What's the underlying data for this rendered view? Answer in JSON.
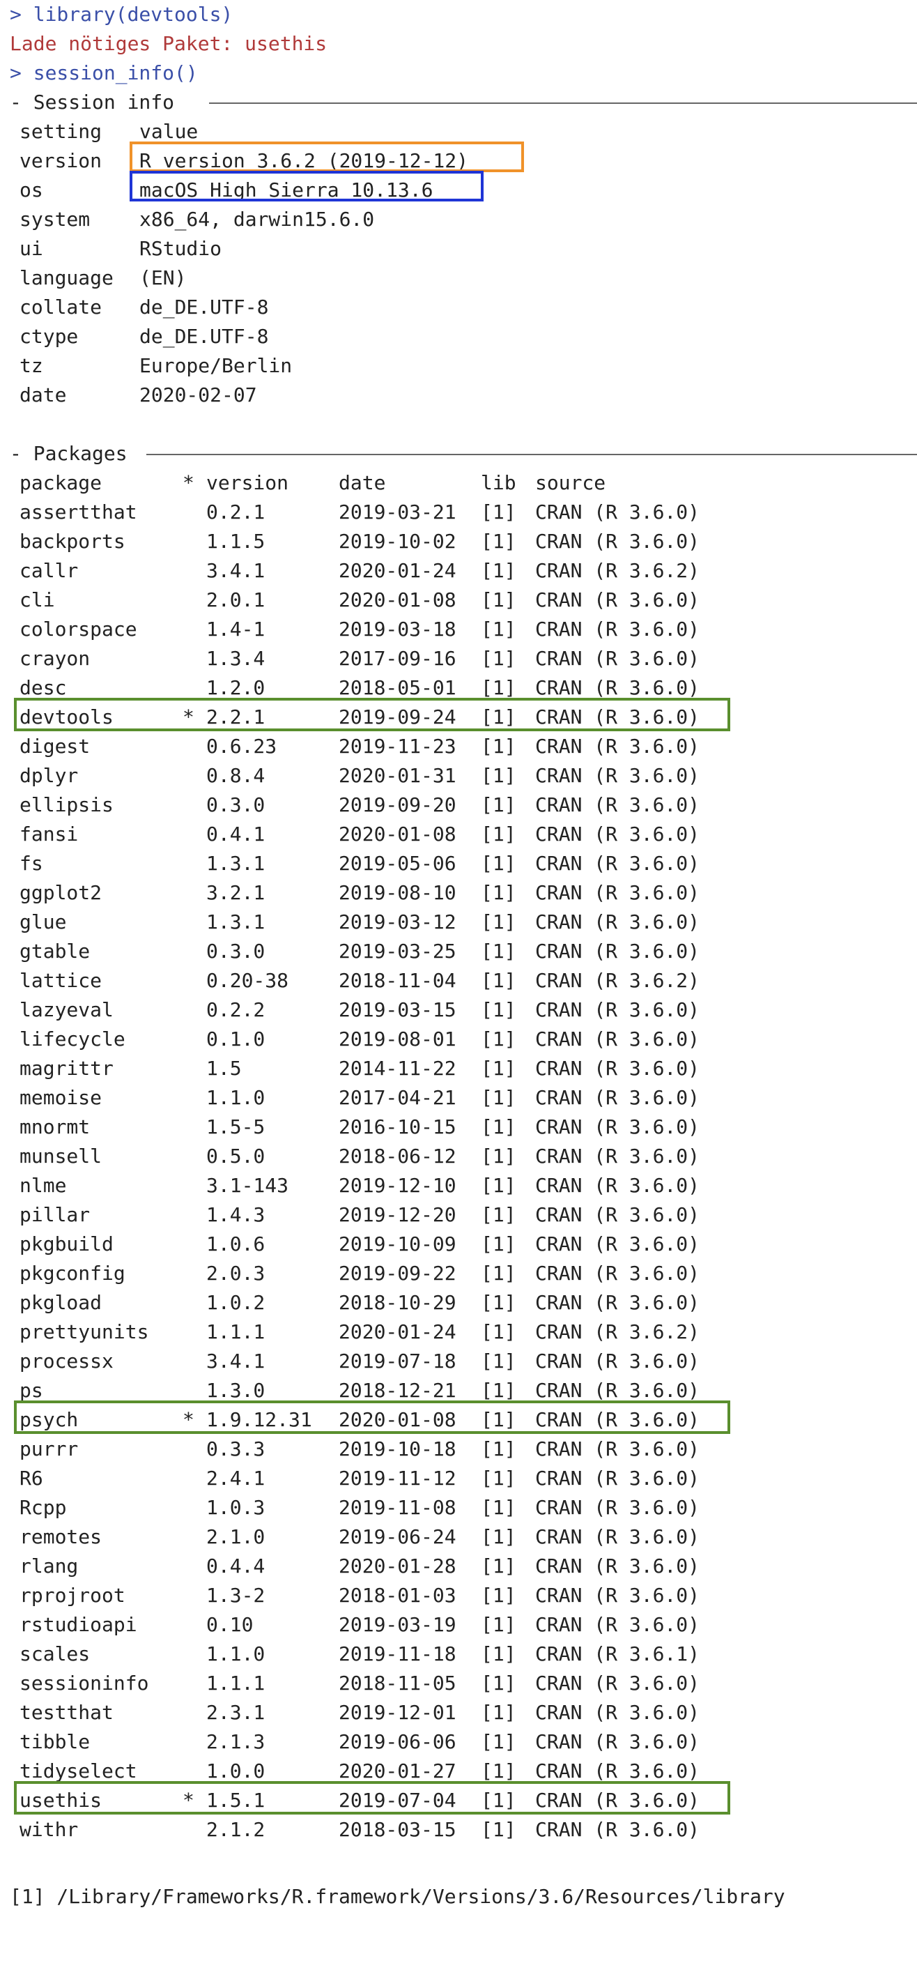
{
  "header": {
    "cmd1": "> library(devtools)",
    "msg": "Lade nötiges Paket: usethis",
    "cmd2": "> session_info()"
  },
  "session": {
    "title": "- Session info",
    "header": [
      "setting",
      "value"
    ],
    "rows": [
      [
        "version",
        "R version 3.6.2 (2019-12-12)"
      ],
      [
        "os",
        "macOS High Sierra 10.13.6"
      ],
      [
        "system",
        "x86_64, darwin15.6.0"
      ],
      [
        "ui",
        "RStudio"
      ],
      [
        "language",
        "(EN)"
      ],
      [
        "collate",
        "de_DE.UTF-8"
      ],
      [
        "ctype",
        "de_DE.UTF-8"
      ],
      [
        "tz",
        "Europe/Berlin"
      ],
      [
        "date",
        "2020-02-07"
      ]
    ]
  },
  "packages": {
    "title": "- Packages",
    "header": {
      "package": "package",
      "star": "*",
      "version": "version",
      "date": "date",
      "lib": "lib",
      "source": "source"
    },
    "rows": [
      [
        "assertthat",
        "",
        "0.2.1",
        "2019-03-21",
        "[1]",
        "CRAN (R 3.6.0)"
      ],
      [
        "backports",
        "",
        "1.1.5",
        "2019-10-02",
        "[1]",
        "CRAN (R 3.6.0)"
      ],
      [
        "callr",
        "",
        "3.4.1",
        "2020-01-24",
        "[1]",
        "CRAN (R 3.6.2)"
      ],
      [
        "cli",
        "",
        "2.0.1",
        "2020-01-08",
        "[1]",
        "CRAN (R 3.6.0)"
      ],
      [
        "colorspace",
        "",
        "1.4-1",
        "2019-03-18",
        "[1]",
        "CRAN (R 3.6.0)"
      ],
      [
        "crayon",
        "",
        "1.3.4",
        "2017-09-16",
        "[1]",
        "CRAN (R 3.6.0)"
      ],
      [
        "desc",
        "",
        "1.2.0",
        "2018-05-01",
        "[1]",
        "CRAN (R 3.6.0)"
      ],
      [
        "devtools",
        "*",
        "2.2.1",
        "2019-09-24",
        "[1]",
        "CRAN (R 3.6.0)"
      ],
      [
        "digest",
        "",
        "0.6.23",
        "2019-11-23",
        "[1]",
        "CRAN (R 3.6.0)"
      ],
      [
        "dplyr",
        "",
        "0.8.4",
        "2020-01-31",
        "[1]",
        "CRAN (R 3.6.0)"
      ],
      [
        "ellipsis",
        "",
        "0.3.0",
        "2019-09-20",
        "[1]",
        "CRAN (R 3.6.0)"
      ],
      [
        "fansi",
        "",
        "0.4.1",
        "2020-01-08",
        "[1]",
        "CRAN (R 3.6.0)"
      ],
      [
        "fs",
        "",
        "1.3.1",
        "2019-05-06",
        "[1]",
        "CRAN (R 3.6.0)"
      ],
      [
        "ggplot2",
        "",
        "3.2.1",
        "2019-08-10",
        "[1]",
        "CRAN (R 3.6.0)"
      ],
      [
        "glue",
        "",
        "1.3.1",
        "2019-03-12",
        "[1]",
        "CRAN (R 3.6.0)"
      ],
      [
        "gtable",
        "",
        "0.3.0",
        "2019-03-25",
        "[1]",
        "CRAN (R 3.6.0)"
      ],
      [
        "lattice",
        "",
        "0.20-38",
        "2018-11-04",
        "[1]",
        "CRAN (R 3.6.2)"
      ],
      [
        "lazyeval",
        "",
        "0.2.2",
        "2019-03-15",
        "[1]",
        "CRAN (R 3.6.0)"
      ],
      [
        "lifecycle",
        "",
        "0.1.0",
        "2019-08-01",
        "[1]",
        "CRAN (R 3.6.0)"
      ],
      [
        "magrittr",
        "",
        "1.5",
        "2014-11-22",
        "[1]",
        "CRAN (R 3.6.0)"
      ],
      [
        "memoise",
        "",
        "1.1.0",
        "2017-04-21",
        "[1]",
        "CRAN (R 3.6.0)"
      ],
      [
        "mnormt",
        "",
        "1.5-5",
        "2016-10-15",
        "[1]",
        "CRAN (R 3.6.0)"
      ],
      [
        "munsell",
        "",
        "0.5.0",
        "2018-06-12",
        "[1]",
        "CRAN (R 3.6.0)"
      ],
      [
        "nlme",
        "",
        "3.1-143",
        "2019-12-10",
        "[1]",
        "CRAN (R 3.6.0)"
      ],
      [
        "pillar",
        "",
        "1.4.3",
        "2019-12-20",
        "[1]",
        "CRAN (R 3.6.0)"
      ],
      [
        "pkgbuild",
        "",
        "1.0.6",
        "2019-10-09",
        "[1]",
        "CRAN (R 3.6.0)"
      ],
      [
        "pkgconfig",
        "",
        "2.0.3",
        "2019-09-22",
        "[1]",
        "CRAN (R 3.6.0)"
      ],
      [
        "pkgload",
        "",
        "1.0.2",
        "2018-10-29",
        "[1]",
        "CRAN (R 3.6.0)"
      ],
      [
        "prettyunits",
        "",
        "1.1.1",
        "2020-01-24",
        "[1]",
        "CRAN (R 3.6.2)"
      ],
      [
        "processx",
        "",
        "3.4.1",
        "2019-07-18",
        "[1]",
        "CRAN (R 3.6.0)"
      ],
      [
        "ps",
        "",
        "1.3.0",
        "2018-12-21",
        "[1]",
        "CRAN (R 3.6.0)"
      ],
      [
        "psych",
        "*",
        "1.9.12.31",
        "2020-01-08",
        "[1]",
        "CRAN (R 3.6.0)"
      ],
      [
        "purrr",
        "",
        "0.3.3",
        "2019-10-18",
        "[1]",
        "CRAN (R 3.6.0)"
      ],
      [
        "R6",
        "",
        "2.4.1",
        "2019-11-12",
        "[1]",
        "CRAN (R 3.6.0)"
      ],
      [
        "Rcpp",
        "",
        "1.0.3",
        "2019-11-08",
        "[1]",
        "CRAN (R 3.6.0)"
      ],
      [
        "remotes",
        "",
        "2.1.0",
        "2019-06-24",
        "[1]",
        "CRAN (R 3.6.0)"
      ],
      [
        "rlang",
        "",
        "0.4.4",
        "2020-01-28",
        "[1]",
        "CRAN (R 3.6.0)"
      ],
      [
        "rprojroot",
        "",
        "1.3-2",
        "2018-01-03",
        "[1]",
        "CRAN (R 3.6.0)"
      ],
      [
        "rstudioapi",
        "",
        "0.10",
        "2019-03-19",
        "[1]",
        "CRAN (R 3.6.0)"
      ],
      [
        "scales",
        "",
        "1.1.0",
        "2019-11-18",
        "[1]",
        "CRAN (R 3.6.1)"
      ],
      [
        "sessioninfo",
        "",
        "1.1.1",
        "2018-11-05",
        "[1]",
        "CRAN (R 3.6.0)"
      ],
      [
        "testthat",
        "",
        "2.3.1",
        "2019-12-01",
        "[1]",
        "CRAN (R 3.6.0)"
      ],
      [
        "tibble",
        "",
        "2.1.3",
        "2019-06-06",
        "[1]",
        "CRAN (R 3.6.0)"
      ],
      [
        "tidyselect",
        "",
        "1.0.0",
        "2020-01-27",
        "[1]",
        "CRAN (R 3.6.0)"
      ],
      [
        "usethis",
        "*",
        "1.5.1",
        "2019-07-04",
        "[1]",
        "CRAN (R 3.6.0)"
      ],
      [
        "withr",
        "",
        "2.1.2",
        "2018-03-15",
        "[1]",
        "CRAN (R 3.6.0)"
      ]
    ]
  },
  "library_path": "[1] /Library/Frameworks/R.framework/Versions/3.6/Resources/library",
  "colors": {
    "prompt": "#3a4fa8",
    "message": "#b03a3a",
    "highlight_version": "#f0922a",
    "highlight_os": "#1f35d6",
    "highlight_packages": "#5a8f2e"
  }
}
